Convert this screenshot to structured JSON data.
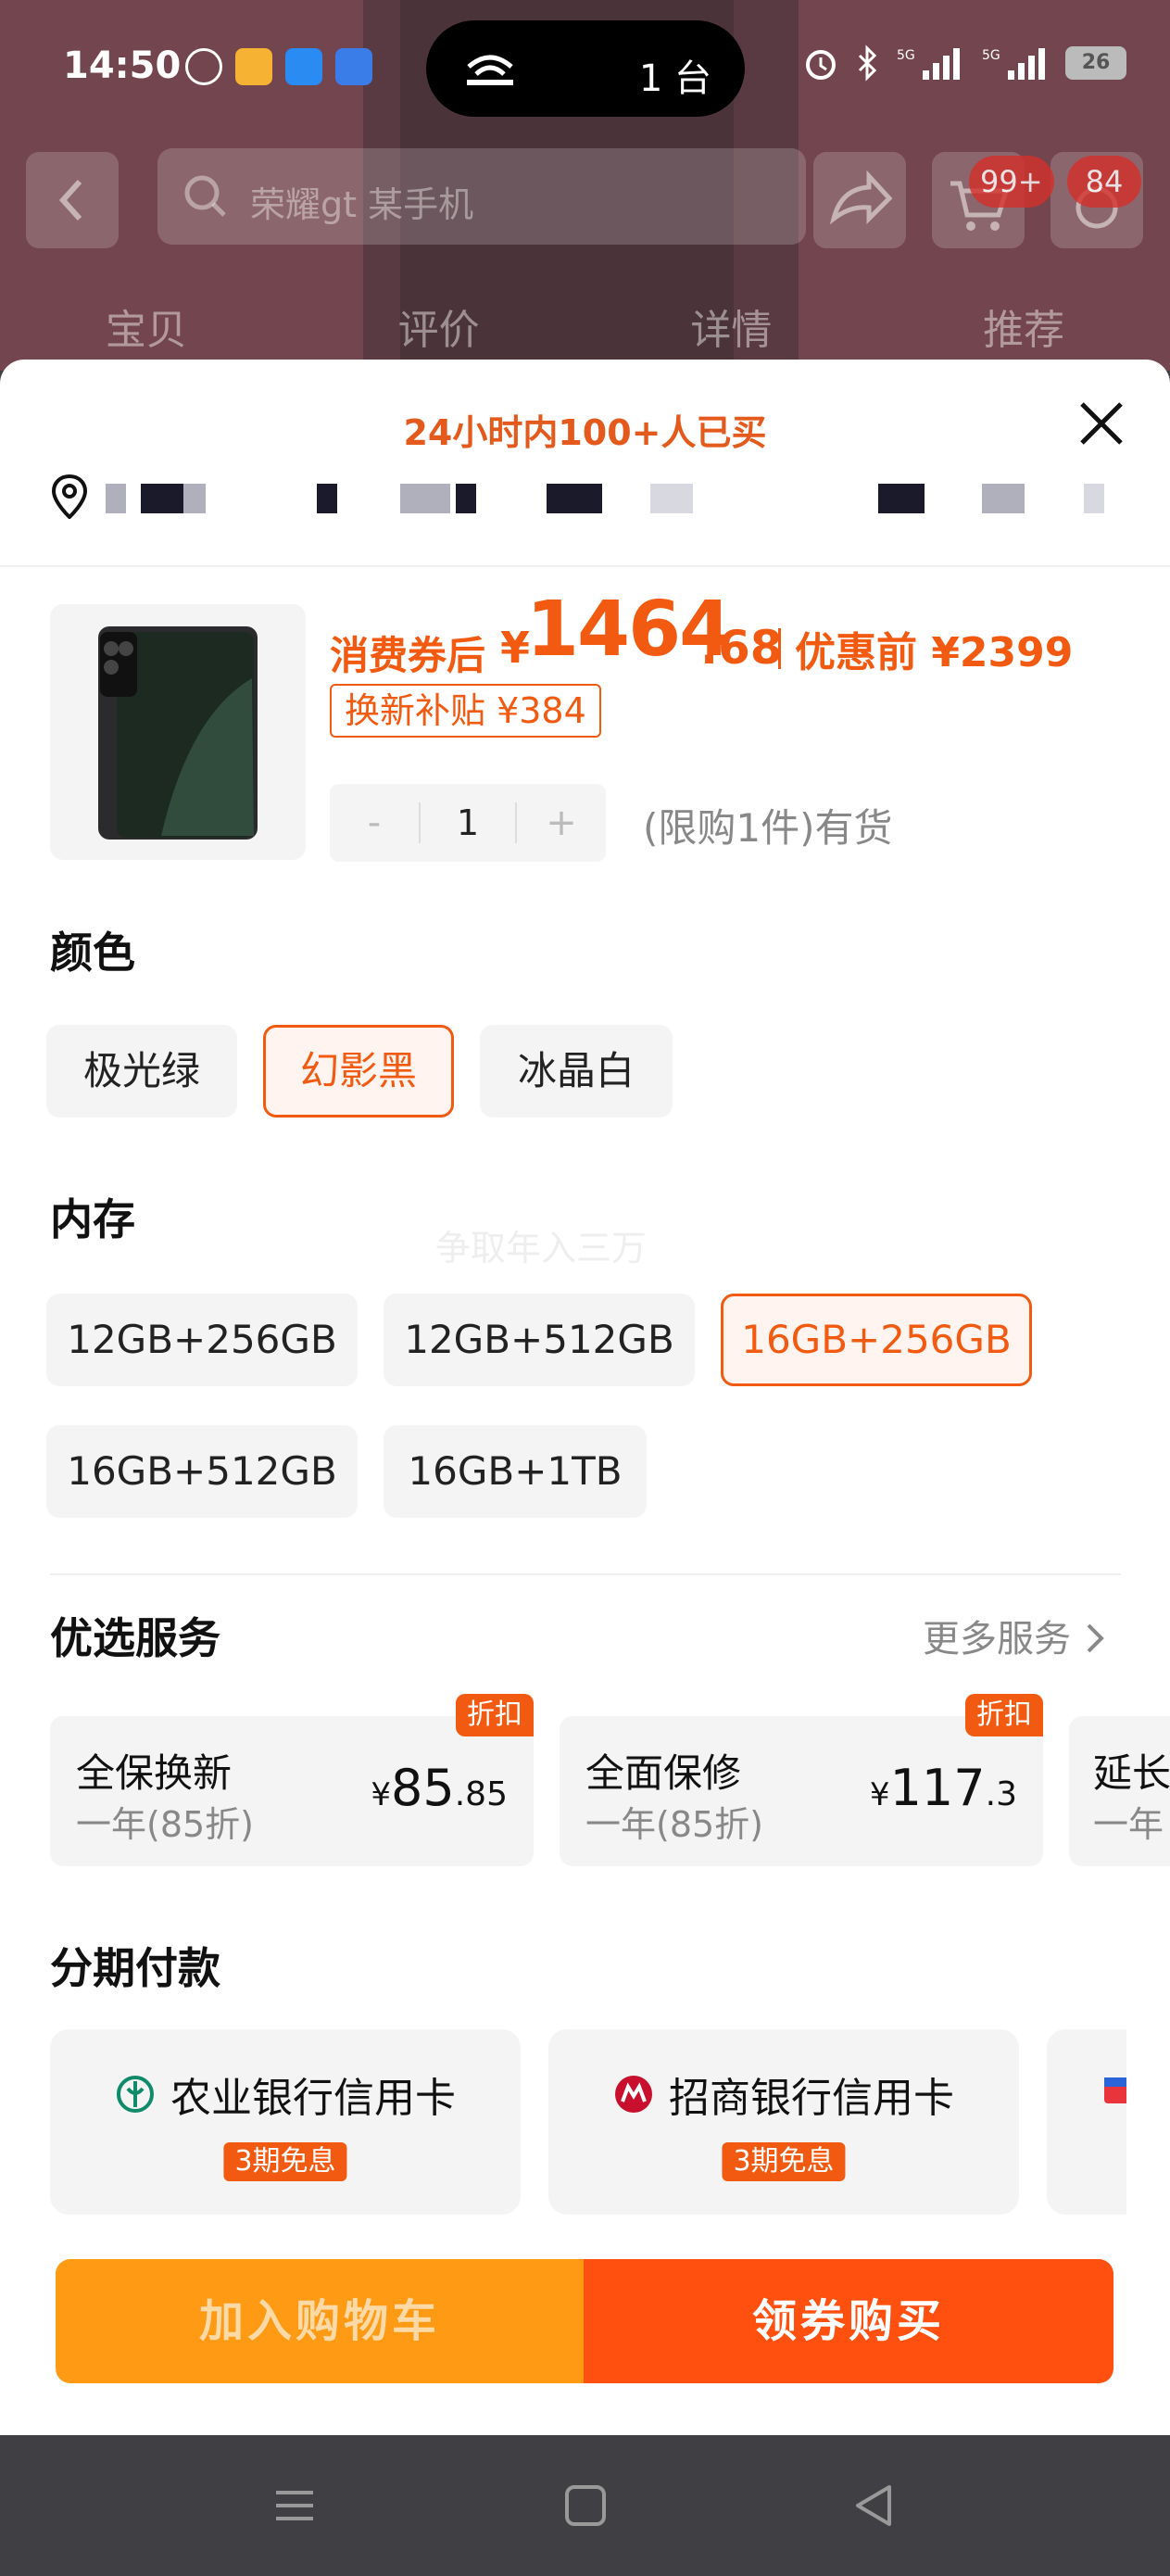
{
  "status_bar": {
    "time": "14:50",
    "cast_count": "1 台",
    "battery": "26"
  },
  "background": {
    "search_placeholder": "荣耀gt 某手机",
    "cart_badge": "99+",
    "msg_badge": "84",
    "tabs": [
      "宝贝",
      "评价",
      "详情",
      "推荐"
    ]
  },
  "sheet": {
    "hot_text": "24小时内100+人已买",
    "price": {
      "coupon_label": "消费券后",
      "currency": "¥",
      "integer": "1464",
      "decimals": ".68",
      "before_label": "优惠前 ¥2399"
    },
    "subsidy": "换新补贴 ¥384",
    "stepper": {
      "minus": "-",
      "qty": "1",
      "plus": "+"
    },
    "stock": "(限购1件)有货",
    "color_title": "颜色",
    "colors": [
      "极光绿",
      "幻影黑",
      "冰晶白"
    ],
    "selected_color": "幻影黑",
    "memory_title": "内存",
    "memory_ghost": "争取年入三万",
    "memory": [
      "12GB+256GB",
      "12GB+512GB",
      "16GB+256GB",
      "16GB+512GB",
      "16GB+1TB"
    ],
    "selected_memory": "16GB+256GB",
    "services_title": "优选服务",
    "more_services": "更多服务",
    "services": [
      {
        "title": "全保换新",
        "sub": "一年(85折)",
        "yen": "¥",
        "int": "85",
        "dec": ".85",
        "badge": "折扣"
      },
      {
        "title": "全面保修",
        "sub": "一年(85折)",
        "yen": "¥",
        "int": "117",
        "dec": ".3",
        "badge": "折扣"
      },
      {
        "title": "延长",
        "sub": "一年"
      }
    ],
    "installment_title": "分期付款",
    "banks": [
      {
        "name": "农业银行信用卡",
        "tag": "3期免息",
        "color": "#0f8a6a"
      },
      {
        "name": "招商银行信用卡",
        "tag": "3期免息",
        "color": "#c8102e"
      }
    ],
    "add_cart": "加入购物车",
    "buy_now": "领券购买"
  },
  "colors": {
    "accent": "#f25a12",
    "cart_button": "#ff9a14",
    "buy_button": "#ff5010"
  }
}
